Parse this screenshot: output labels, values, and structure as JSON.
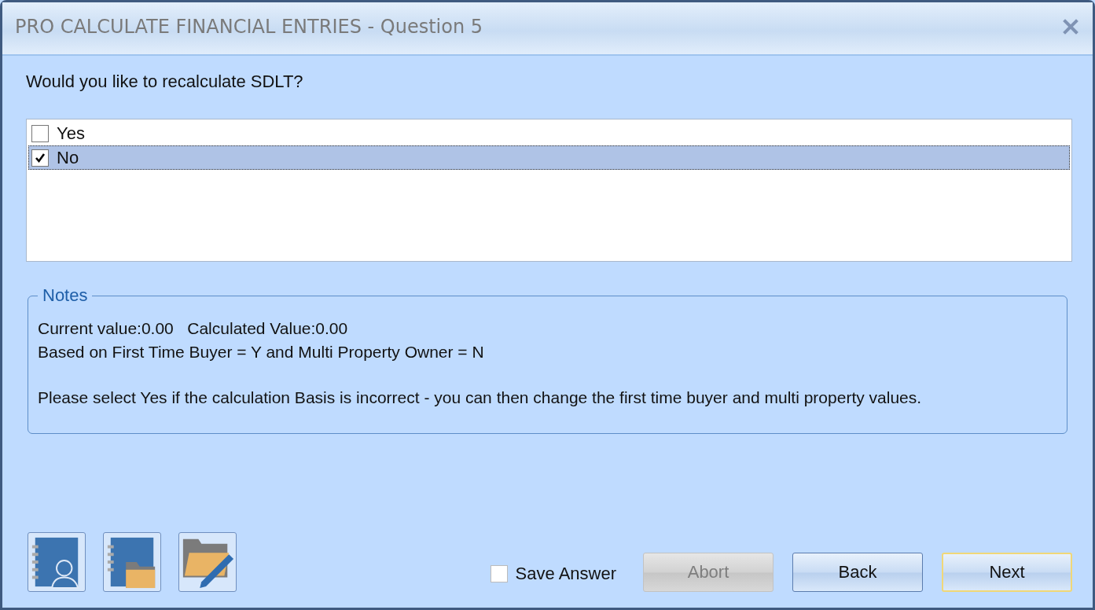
{
  "window": {
    "title": "PRO CALCULATE FINANCIAL ENTRIES - Question 5"
  },
  "question": "Would you like to recalculate SDLT?",
  "options": [
    {
      "label": "Yes",
      "checked": false,
      "selected": false
    },
    {
      "label": "No",
      "checked": true,
      "selected": true
    }
  ],
  "notes": {
    "legend": "Notes",
    "lines": [
      "Current value:0.00   Calculated Value:0.00",
      "Based on First Time Buyer = Y and Multi Property Owner = N"
    ],
    "paragraph": "Please select Yes if the calculation Basis is incorrect - you can then change the first time buyer and multi property values."
  },
  "save_answer": {
    "label": "Save Answer",
    "checked": false
  },
  "buttons": [
    {
      "label": "Abort",
      "disabled": true,
      "default": false
    },
    {
      "label": "Back",
      "disabled": false,
      "default": false
    },
    {
      "label": "Next",
      "disabled": false,
      "default": true
    }
  ]
}
